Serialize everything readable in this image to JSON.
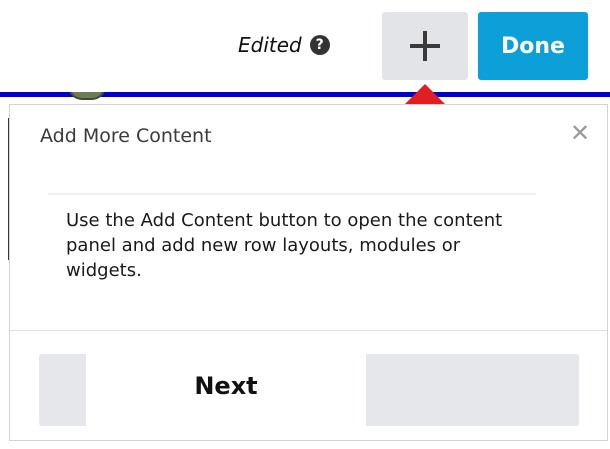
{
  "toolbar": {
    "edited_label": "Edited",
    "help_icon": "question-circle-icon",
    "help_glyph": "?",
    "add_icon": "plus-icon",
    "done_label": "Done",
    "done_color": "#0c9fd8"
  },
  "tour": {
    "title": "Add More Content",
    "close_glyph": "✕",
    "close_icon": "close-icon",
    "body_text": "Use the Add Content button to open the content panel and add new row layouts, modules or widgets.",
    "next_label": "Next",
    "pointer_color": "#e02020"
  }
}
